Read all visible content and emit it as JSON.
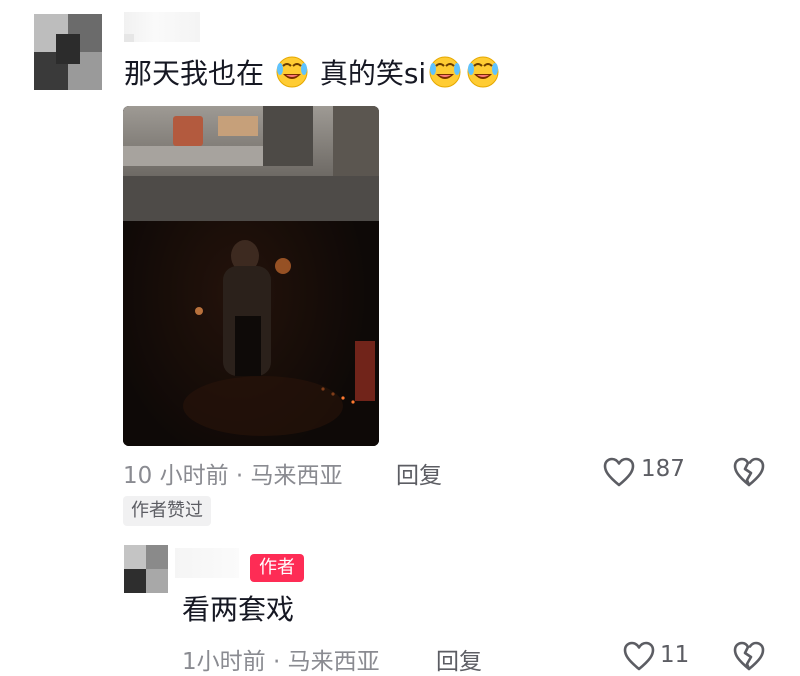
{
  "comment": {
    "text": "那天我也在",
    "text_after": "真的笑si",
    "emoji_icon": "crying-laughing-emoji",
    "time": "10 小时前 · 马来西亚",
    "reply_label": "回复",
    "like_count": "187",
    "author_liked_badge": "作者赞过"
  },
  "reply": {
    "author_badge": "作者",
    "text": "看两套戏",
    "time": "1小时前 · 马来西亚",
    "reply_label": "回复",
    "like_count": "11"
  },
  "colors": {
    "accent": "#fe2c55",
    "text_primary": "#161823",
    "text_secondary": "#8a8b91"
  },
  "icons": {
    "like": "heart-outline-icon",
    "dislike": "broken-heart-icon"
  }
}
